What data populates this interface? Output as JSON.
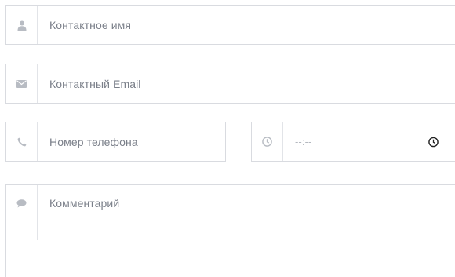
{
  "form": {
    "name": {
      "placeholder": "Контактное имя",
      "icon": "user-icon"
    },
    "email": {
      "placeholder": "Контактный Email",
      "icon": "envelope-icon"
    },
    "phone": {
      "placeholder": "Номер телефона",
      "icon": "phone-icon"
    },
    "time": {
      "value": "--:--",
      "icon": "clock-icon",
      "picker_icon": "clock-icon"
    },
    "comment": {
      "placeholder": "Комментарий",
      "icon": "comment-icon"
    }
  },
  "colors": {
    "border": "#d9dbe0",
    "icon": "#b8bcc3",
    "text": "#7a7f89"
  }
}
